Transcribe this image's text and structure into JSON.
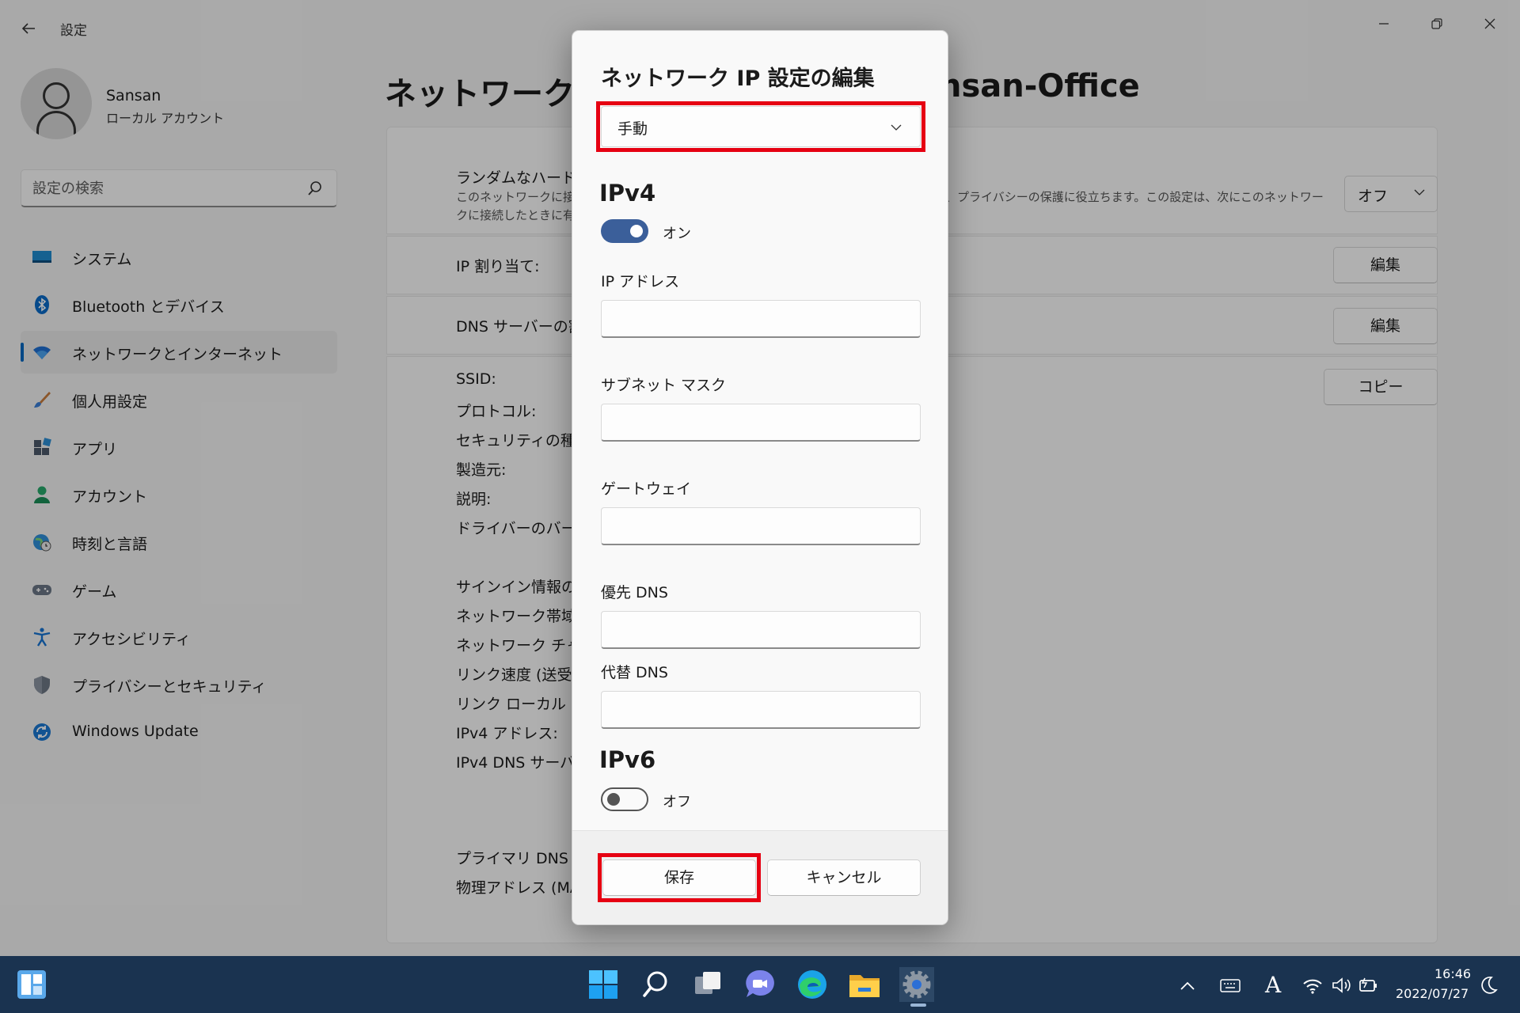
{
  "window": {
    "app_title": "設定",
    "page_title": "ネットワークとイ",
    "page_title_tail": "nsan-Office"
  },
  "user": {
    "name": "Sansan",
    "account_type": "ローカル アカウント"
  },
  "search": {
    "placeholder": "設定の検索"
  },
  "sidebar": {
    "items": [
      {
        "label": "システム",
        "icon": "system-icon"
      },
      {
        "label": "Bluetooth とデバイス",
        "icon": "bluetooth-icon"
      },
      {
        "label": "ネットワークとインターネット",
        "icon": "wifi-icon",
        "active": true
      },
      {
        "label": "個人用設定",
        "icon": "brush-icon"
      },
      {
        "label": "アプリ",
        "icon": "apps-icon"
      },
      {
        "label": "アカウント",
        "icon": "account-icon"
      },
      {
        "label": "時刻と言語",
        "icon": "globe-clock-icon"
      },
      {
        "label": "ゲーム",
        "icon": "gamepad-icon"
      },
      {
        "label": "アクセシビリティ",
        "icon": "accessibility-icon"
      },
      {
        "label": "プライバシーとセキュリティ",
        "icon": "shield-icon"
      },
      {
        "label": "Windows Update",
        "icon": "update-icon"
      }
    ]
  },
  "main": {
    "random_hw": {
      "label": "ランダムなハードウェ",
      "desc_line1": "このネットワークに接続",
      "desc_line2": "クに接続したときに有",
      "desc_tail": "、プライバシーの保護に役立ちます。この設定は、次にこのネットワー",
      "select_value": "オフ"
    },
    "ip_assign": {
      "label": "IP 割り当て:",
      "button": "編集"
    },
    "dns_assign": {
      "label": "DNS サーバーの割",
      "button": "編集"
    },
    "details": {
      "copy_button": "コピー",
      "labels": [
        "SSID:",
        "プロトコル:",
        "セキュリティの種類",
        "製造元:",
        "説明:",
        "ドライバーのバージョ"
      ],
      "labels2": [
        "サインイン情報の種",
        "ネットワーク帯域:",
        "ネットワーク チャネ",
        "リンク速度 (送受信",
        "リンク ローカル IPv",
        "IPv4 アドレス:",
        "IPv4 DNS サーバー"
      ],
      "labels3": [
        "プライマリ DNS サ",
        "物理アドレス (MA"
      ]
    }
  },
  "dialog": {
    "title": "ネットワーク IP 設定の編集",
    "mode_value": "手動",
    "ipv4": {
      "heading": "IPv4",
      "toggle_on": true,
      "toggle_label": "オン",
      "fields": [
        {
          "label": "IP アドレス",
          "value": ""
        },
        {
          "label": "サブネット マスク",
          "value": ""
        },
        {
          "label": "ゲートウェイ",
          "value": ""
        },
        {
          "label": "優先 DNS",
          "value": ""
        },
        {
          "label": "代替 DNS",
          "value": ""
        }
      ]
    },
    "ipv6": {
      "heading": "IPv6",
      "toggle_on": false,
      "toggle_label": "オフ"
    },
    "save_label": "保存",
    "cancel_label": "キャンセル",
    "highlight_color": "#e60012"
  },
  "taskbar": {
    "icons": [
      "start-icon",
      "search-icon",
      "task-view-icon",
      "chat-icon",
      "edge-icon",
      "file-explorer-icon",
      "settings-icon"
    ],
    "tray": [
      "chevron-up-icon",
      "keyboard-icon",
      "ime-icon",
      "wifi-icon",
      "volume-icon",
      "battery-icon"
    ],
    "ime_label": "A",
    "time": "16:46",
    "date": "2022/07/27"
  },
  "colors": {
    "accent": "#0067c0",
    "taskbar": "#1a3350",
    "toggle_on": "#3b5f9a"
  }
}
